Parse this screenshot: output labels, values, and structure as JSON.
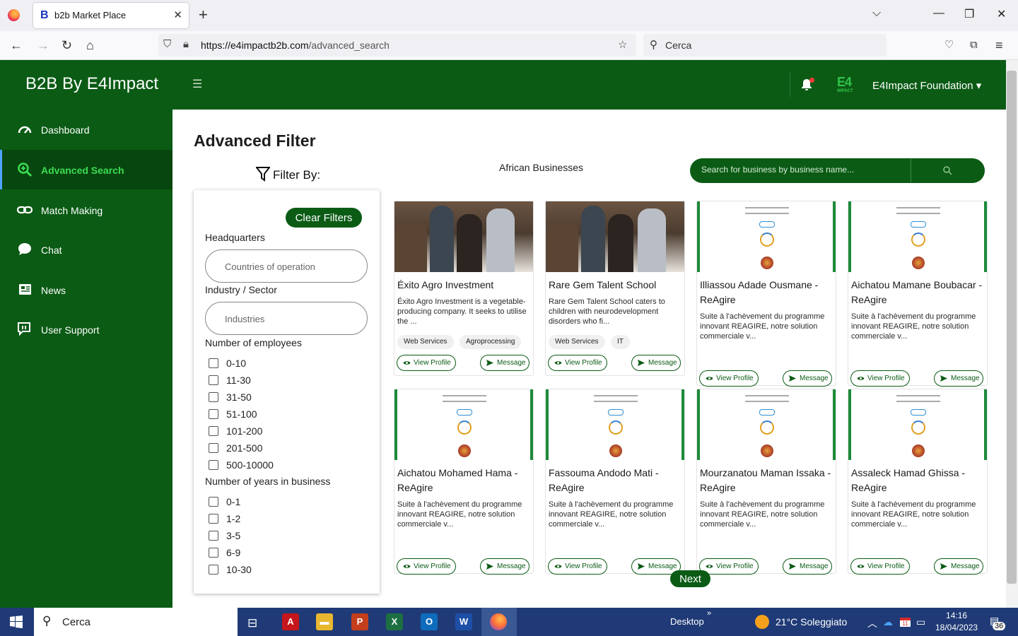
{
  "browser": {
    "tab_title": "b2b Market Place",
    "tab_favicon": "B",
    "url_host": "https://e4impactb2b.com",
    "url_path": "/advanced_search",
    "search_placeholder": "Cerca"
  },
  "header": {
    "brand": "B2B By E4Impact",
    "org_logo": "E4",
    "org_logo_small": "IMPACT",
    "org_name": "E4Impact Foundation ▾"
  },
  "sidebar": {
    "items": [
      {
        "label": "Dashboard",
        "icon": "speedometer-icon"
      },
      {
        "label": "Advanced Search",
        "icon": "zoom-plus-icon",
        "active": true
      },
      {
        "label": "Match Making",
        "icon": "link-icon"
      },
      {
        "label": "Chat",
        "icon": "chat-bubble-icon"
      },
      {
        "label": "News",
        "icon": "newspaper-icon"
      },
      {
        "label": "User Support",
        "icon": "support-chat-icon"
      }
    ]
  },
  "main": {
    "title": "Advanced Filter",
    "filter_by": "Filter By:",
    "section": "African Businesses",
    "search_placeholder": "Search for business by business name...",
    "next": "Next"
  },
  "filters": {
    "clear": "Clear Filters",
    "headquarters_label": "Headquarters",
    "headquarters_placeholder": "Countries of operation",
    "industry_label": "Industry / Sector",
    "industry_placeholder": "Industries",
    "employees_label": "Number of employees",
    "employees": [
      "0-10",
      "11-30",
      "31-50",
      "51-100",
      "101-200",
      "201-500",
      "500-10000"
    ],
    "years_label": "Number of years in business",
    "years": [
      "0-1",
      "1-2",
      "3-5",
      "6-9",
      "10-30"
    ]
  },
  "cards": [
    {
      "name": "Éxito Agro Investment",
      "desc": "Éxito Agro Investment is a vegetable-producing company. It seeks to utilise the ...",
      "tags": [
        "Web Services",
        "Agroprocessing"
      ],
      "image": "photo"
    },
    {
      "name": "Rare Gem Talent School",
      "desc": "Rare Gem Talent School caters to children with neurodevelopment disorders who fi...",
      "tags": [
        "Web Services",
        "IT"
      ],
      "image": "photo"
    },
    {
      "name": "Illiassou Adade Ousmane - ReAgire",
      "desc": "Suite à l'achèvement du programme innovant REAGIRE, notre solution commerciale v...",
      "tags": [],
      "image": "logo"
    },
    {
      "name": "Aichatou Mamane Boubacar - ReAgire",
      "desc": "Suite à l'achèvement du programme innovant REAGIRE, notre solution commerciale v...",
      "tags": [],
      "image": "logo"
    },
    {
      "name": "Aichatou Mohamed Hama - ReAgire",
      "desc": "Suite à l'achèvement du programme innovant REAGIRE, notre solution commerciale v...",
      "tags": [],
      "image": "logo"
    },
    {
      "name": "Fassouma Andodo Mati - ReAgire",
      "desc": "Suite à l'achèvement du programme innovant REAGIRE, notre solution commerciale v...",
      "tags": [],
      "image": "logo"
    },
    {
      "name": "Mourzanatou Maman Issaka - ReAgire",
      "desc": "Suite à l'achèvement du programme innovant REAGIRE, notre solution commerciale v...",
      "tags": [],
      "image": "logo"
    },
    {
      "name": "Assaleck Hamad Ghissa - ReAgire",
      "desc": "Suite à l'achèvement du programme innovant REAGIRE, notre solution commerciale v...",
      "tags": [],
      "image": "logo"
    }
  ],
  "card_buttons": {
    "view": "View Profile",
    "message": "Message"
  },
  "taskbar": {
    "search": "Cerca",
    "desktop": "Desktop",
    "weather": "21°C  Soleggiato",
    "time": "14:16",
    "date": "18/04/2023",
    "notif_count": "36",
    "calendar_badge": "11"
  },
  "colors": {
    "brand_green": "#0b5b15",
    "active_accent": "#3ddc52",
    "taskbar": "#1f3a76"
  }
}
